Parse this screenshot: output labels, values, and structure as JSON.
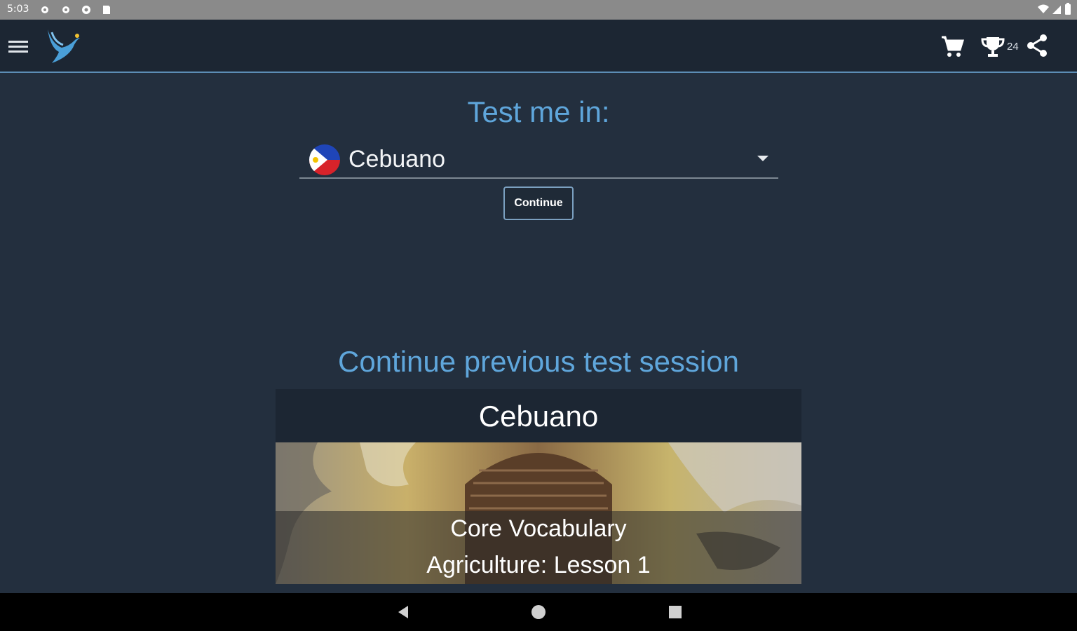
{
  "status_bar": {
    "time": "5:03",
    "icons": [
      "gear-icon",
      "gear-icon",
      "shield-icon",
      "sd-card-icon"
    ],
    "right_icons": [
      "wifi-icon",
      "signal-icon",
      "battery-icon"
    ]
  },
  "app_bar": {
    "icons": [
      "menu-icon",
      "bird-logo",
      "cart-icon",
      "trophy-icon",
      "share-icon"
    ],
    "trophy_count": "24"
  },
  "main": {
    "test_title": "Test me in:",
    "language_select": {
      "selected": "Cebuano",
      "flag": "philippines-flag-icon"
    },
    "continue_label": "Continue",
    "previous_title": "Continue previous test session",
    "session_card": {
      "language": "Cebuano",
      "course": "Core Vocabulary",
      "lesson": "Agriculture: Lesson 1"
    }
  },
  "nav_bar": {
    "icons": [
      "back-icon",
      "home-icon",
      "recents-icon"
    ]
  },
  "colors": {
    "background": "#232f3e",
    "app_bar": "#1c2633",
    "accent_text": "#5fa6db"
  }
}
